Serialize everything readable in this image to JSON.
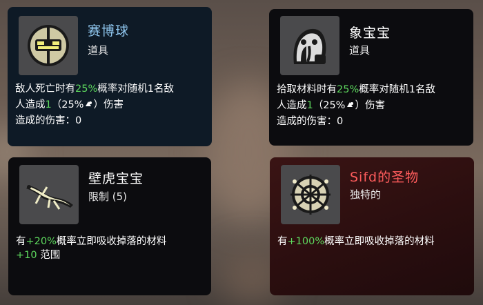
{
  "colors": {
    "positive": "#5ed95e",
    "title_blue": "#8fc6ee",
    "title_red": "#ff5c5c",
    "text": "#ffffff"
  },
  "items": [
    {
      "name": "赛博球",
      "category": "道具",
      "icon": "cyber-ball-icon",
      "line1_pre": "敌人死亡时有",
      "line1_pct": "25%",
      "line1_post": "概率对随机1名敌",
      "line2_pre": "人造成",
      "line2_dmg": "1",
      "line2_scale": "（25%",
      "line2_end": "）伤害",
      "line3": "造成的伤害：0"
    },
    {
      "name": "象宝宝",
      "category": "道具",
      "icon": "baby-elephant-icon",
      "line1_pre": "拾取材料时有",
      "line1_pct": "25%",
      "line1_post": "概率对随机1名敌",
      "line2_pre": "人造成",
      "line2_dmg": "1",
      "line2_scale": "（25%",
      "line2_end": "）伤害",
      "line3": "造成的伤害：0"
    },
    {
      "name": "壁虎宝宝",
      "category": "限制 (5)",
      "icon": "baby-gecko-icon",
      "line1_pre": "有",
      "line1_pct": "+20%",
      "line1_post": "概率立即吸收掉落的材料",
      "line2_val": "+10",
      "line2_post": " 范围"
    },
    {
      "name": "Sifd的圣物",
      "category": "独特的",
      "icon": "sifds-relic-icon",
      "line1_pre": "有",
      "line1_pct": "+100%",
      "line1_post": "概率立即吸收掉落的材料"
    }
  ]
}
